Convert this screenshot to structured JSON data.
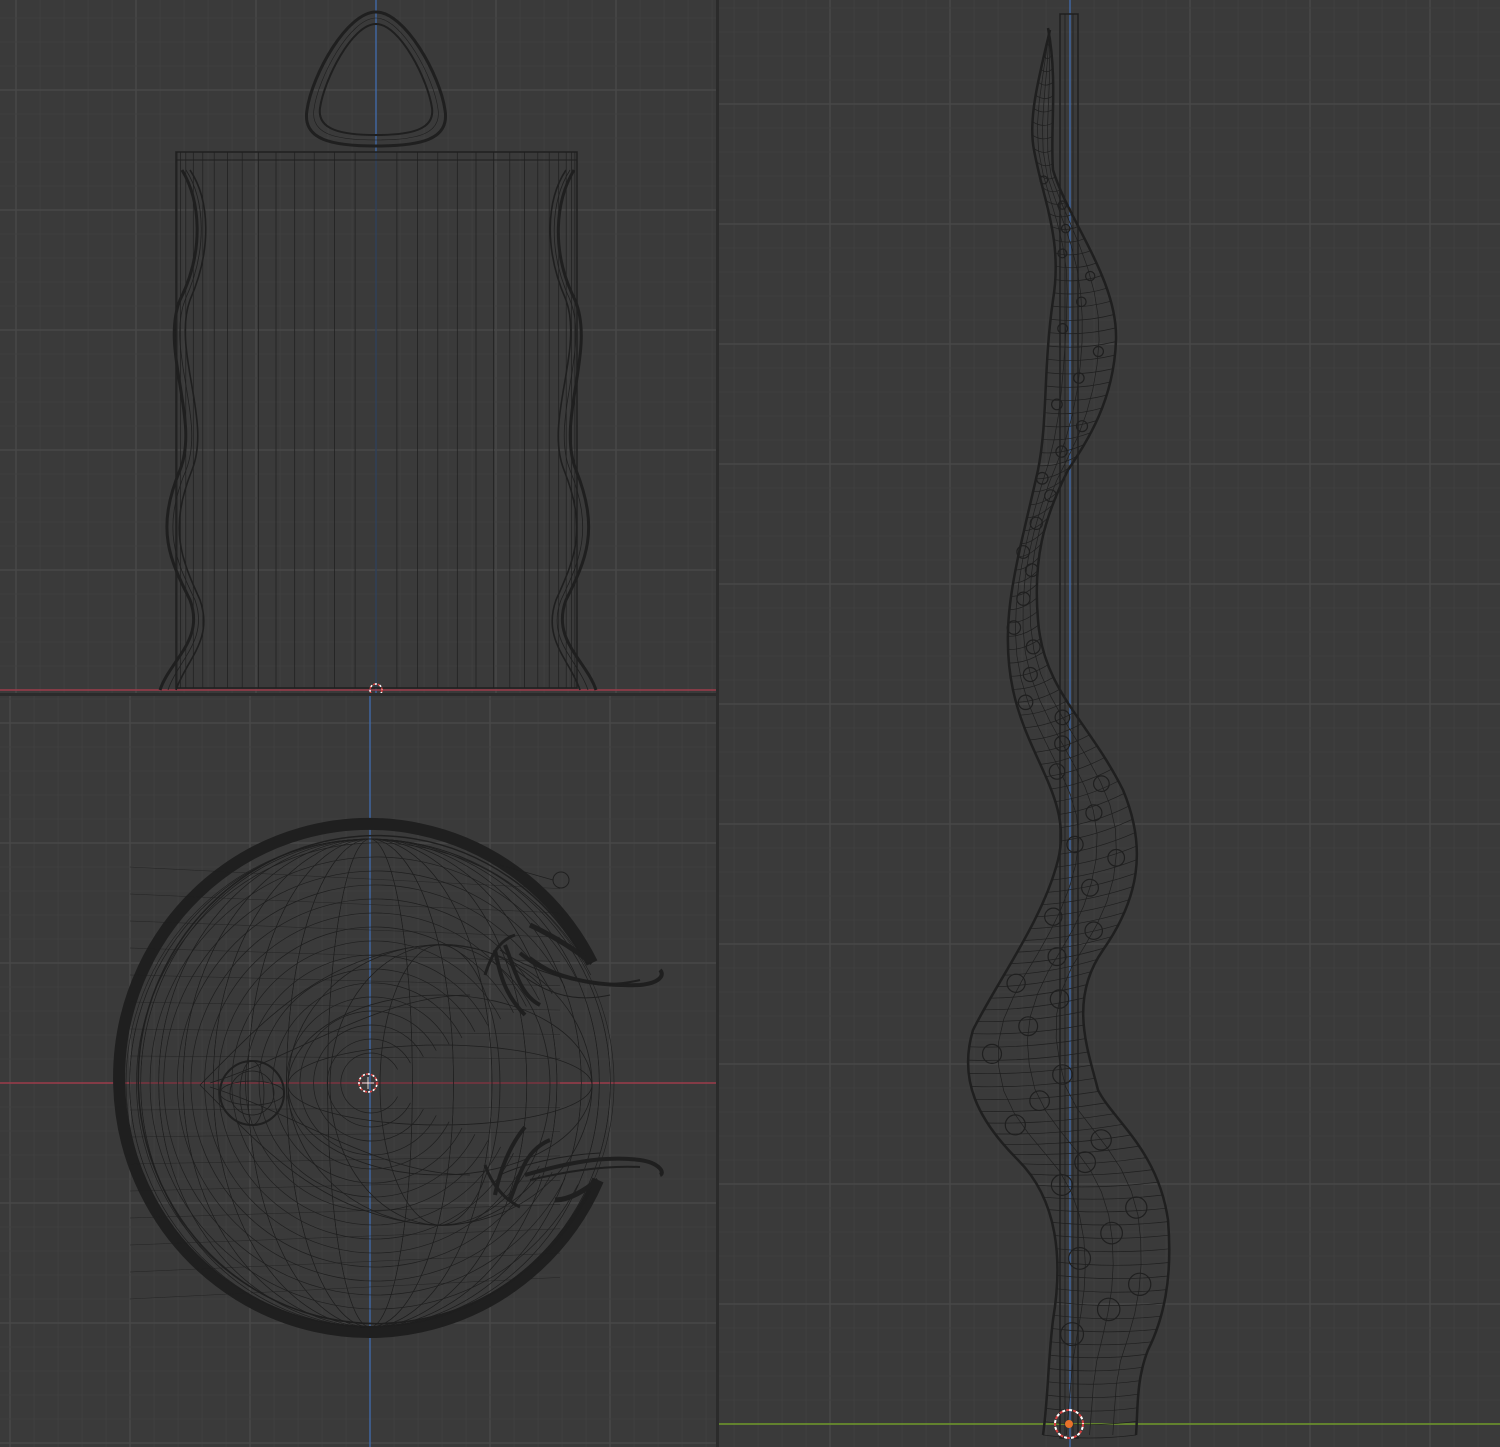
{
  "app": {
    "viewports": [
      {
        "id": "front",
        "kind": "front-orthographic-wireframe"
      },
      {
        "id": "top",
        "kind": "top-orthographic-wireframe"
      },
      {
        "id": "side",
        "kind": "side-orthographic-wireframe"
      }
    ],
    "icons": [
      "3d-cursor-icon",
      "object-origin-icon"
    ]
  },
  "colors": {
    "background": "#3a3a3a",
    "grid_minor": "#424242",
    "grid_major": "#4a4a4a",
    "wire": "#1f1f1f",
    "x_axis": "#9c3b4a",
    "y_axis": "#6f9a2a",
    "z_axis": "#3f6fb6",
    "cursor_red": "#d84040",
    "origin_orange": "#e8722a"
  }
}
